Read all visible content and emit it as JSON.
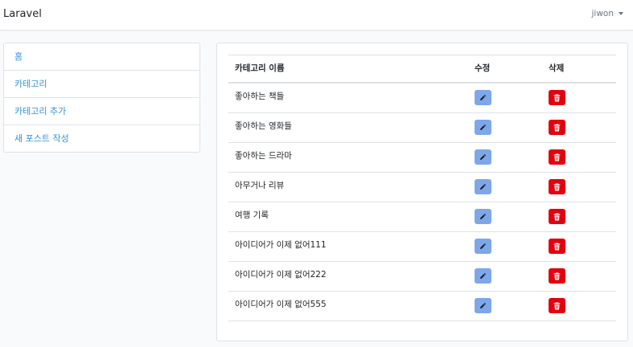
{
  "navbar": {
    "brand": "Laravel",
    "user": "jiwon"
  },
  "sidebar": {
    "items": [
      {
        "label": "홈"
      },
      {
        "label": "카테고리"
      },
      {
        "label": "카테고리 추가"
      },
      {
        "label": "새 포스트 작성"
      }
    ]
  },
  "table": {
    "headers": {
      "name": "카테고리 이름",
      "edit": "수정",
      "delete": "삭제"
    },
    "rows": [
      {
        "name": "좋아하는 책들"
      },
      {
        "name": "좋아하는 영화들"
      },
      {
        "name": "좋아하는 드라마"
      },
      {
        "name": "아무거나 리뷰"
      },
      {
        "name": "여행 기록"
      },
      {
        "name": "아이디어가 이제 없어111"
      },
      {
        "name": "아이디어가 이제 없어222"
      },
      {
        "name": "아이디어가 이제 없어555"
      }
    ]
  },
  "colors": {
    "link": "#3490dc",
    "edit_button": "#7ea7ea",
    "delete_button": "#e3000f"
  },
  "icons": {
    "edit": "pencil-icon",
    "delete": "trash-icon",
    "user_menu": "caret-down-icon"
  }
}
